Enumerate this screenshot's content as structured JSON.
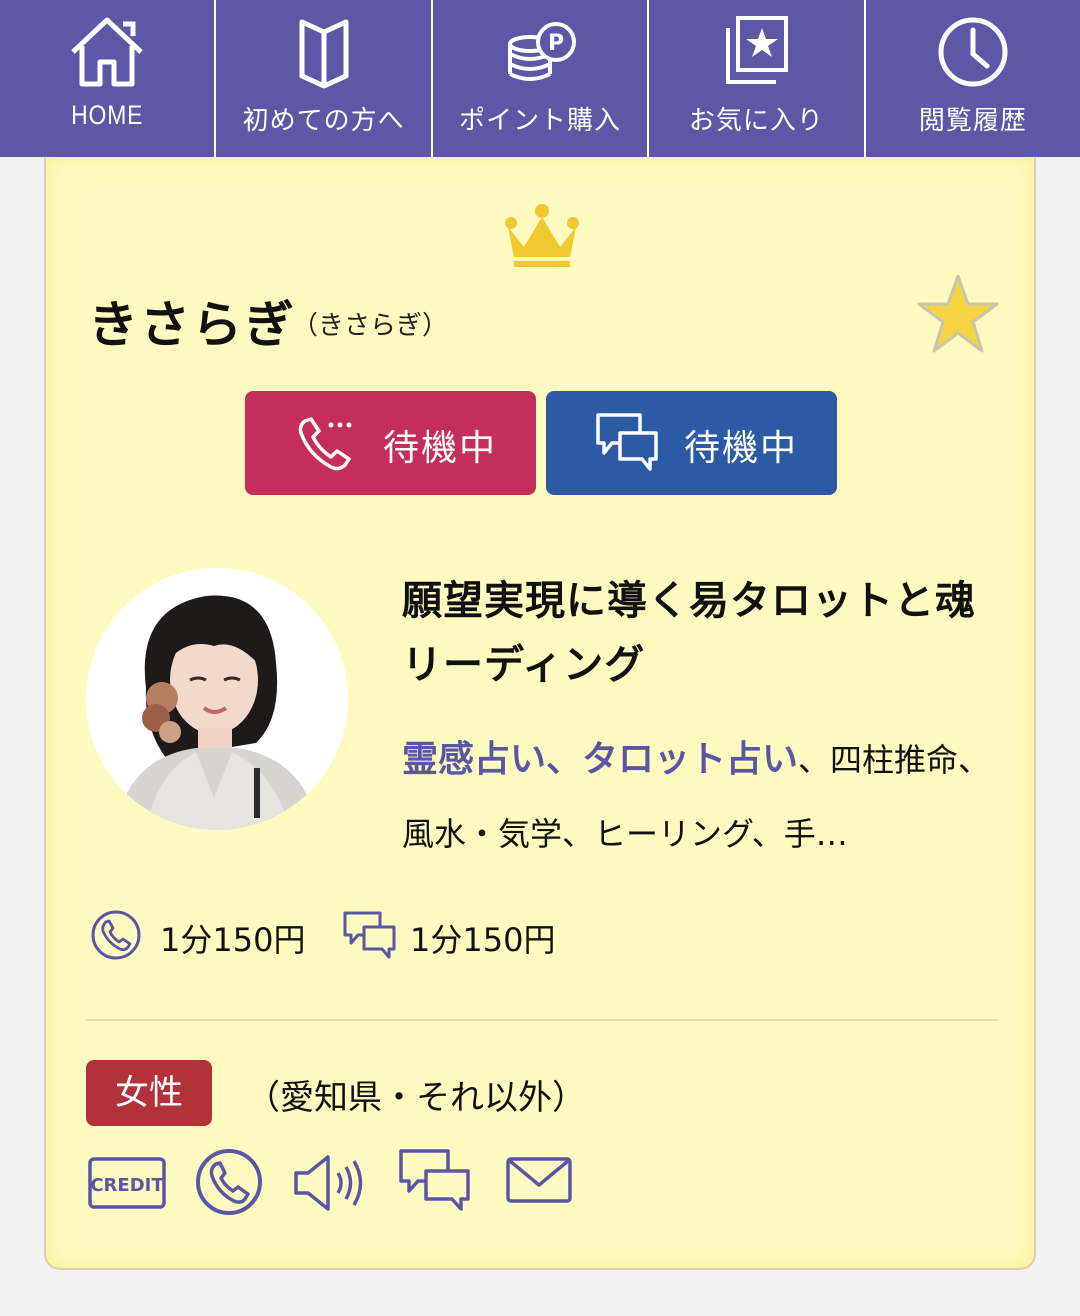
{
  "nav": {
    "items": [
      {
        "label": "HOME",
        "icon": "home-icon"
      },
      {
        "label": "初めての方へ",
        "icon": "book-icon"
      },
      {
        "label": "ポイント購入",
        "icon": "coins-icon"
      },
      {
        "label": "お気に入り",
        "icon": "favorites-icon"
      },
      {
        "label": "閲覧履歴",
        "icon": "clock-icon"
      }
    ]
  },
  "profile": {
    "name": "きさらぎ",
    "reading": "（きさらぎ）",
    "status": {
      "phone_label": "待機中",
      "chat_label": "待機中"
    },
    "title": "願望実現に導く易タロットと魂リーディング",
    "genres": {
      "highlighted": "霊感占い、タロット占い",
      "rest": "、四柱推命、風水・気学、ヒーリング、手…"
    },
    "prices": {
      "phone": "1分150円",
      "chat": "1分150円"
    },
    "gender": "女性",
    "location": "（愛知県・それ以外）",
    "features": [
      "credit-icon",
      "phone-icon",
      "voice-icon",
      "chat-icon",
      "mail-icon"
    ]
  },
  "colors": {
    "nav_bg": "#5c58a6",
    "card_bg": "#fffbc0",
    "phone_button": "#c52e5a",
    "chat_button": "#2c5aa4",
    "accent": "#5a56a6",
    "gender_badge": "#b3313b",
    "crown": "#f2c830"
  }
}
